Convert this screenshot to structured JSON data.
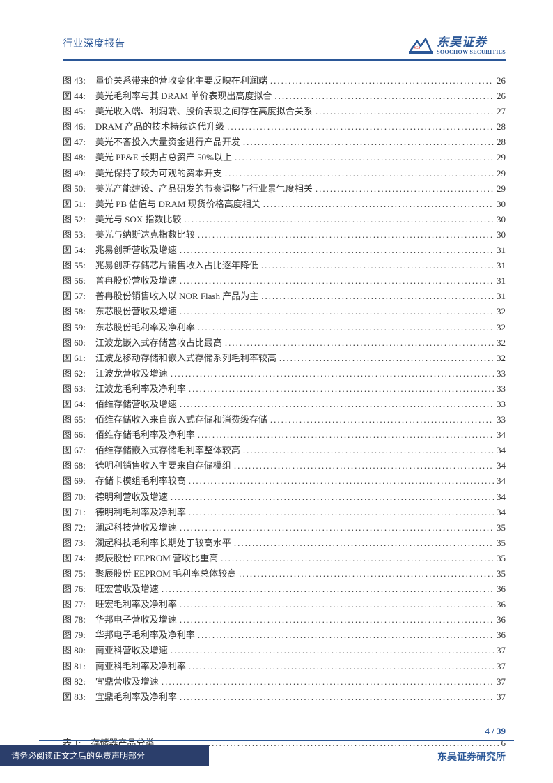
{
  "header": {
    "doc_title": "行业深度报告",
    "logo_cn": "东吴证券",
    "logo_en": "SOOCHOW SECURITIES"
  },
  "toc": {
    "figures": [
      {
        "num": "图 43:",
        "title": "量价关系带来的营收变化主要反映在利润端",
        "page": "26"
      },
      {
        "num": "图 44:",
        "title": "美光毛利率与其 DRAM 单价表现出高度拟合",
        "page": "26"
      },
      {
        "num": "图 45:",
        "title": "美光收入端、利润端、股价表现之间存在高度拟合关系",
        "page": "27"
      },
      {
        "num": "图 46:",
        "title": "DRAM 产品的技术持续迭代升级",
        "page": "28"
      },
      {
        "num": "图 47:",
        "title": "美光不吝投入大量资金进行产品开发",
        "page": "28"
      },
      {
        "num": "图 48:",
        "title": "美光 PP&E 长期占总资产 50%以上",
        "page": "29"
      },
      {
        "num": "图 49:",
        "title": "美光保持了较为可观的资本开支",
        "page": "29"
      },
      {
        "num": "图 50:",
        "title": "美光产能建设、产品研发的节奏调整与行业景气度相关",
        "page": "29"
      },
      {
        "num": "图 51:",
        "title": "美光 PB 估值与 DRAM 现货价格高度相关",
        "page": "30"
      },
      {
        "num": "图 52:",
        "title": "美光与 SOX 指数比较",
        "page": "30"
      },
      {
        "num": "图 53:",
        "title": "美光与纳斯达克指数比较",
        "page": "30"
      },
      {
        "num": "图 54:",
        "title": "兆易创新营收及增速",
        "page": "31"
      },
      {
        "num": "图 55:",
        "title": "兆易创新存储芯片销售收入占比逐年降低",
        "page": "31"
      },
      {
        "num": "图 56:",
        "title": "普冉股份营收及增速",
        "page": "31"
      },
      {
        "num": "图 57:",
        "title": "普冉股份销售收入以 NOR Flash 产品为主",
        "page": "31"
      },
      {
        "num": "图 58:",
        "title": "东芯股份营收及增速",
        "page": "32"
      },
      {
        "num": "图 59:",
        "title": "东芯股份毛利率及净利率",
        "page": "32"
      },
      {
        "num": "图 60:",
        "title": "江波龙嵌入式存储营收占比最高",
        "page": "32"
      },
      {
        "num": "图 61:",
        "title": "江波龙移动存储和嵌入式存储系列毛利率较高",
        "page": "32"
      },
      {
        "num": "图 62:",
        "title": "江波龙营收及增速",
        "page": "33"
      },
      {
        "num": "图 63:",
        "title": "江波龙毛利率及净利率",
        "page": "33"
      },
      {
        "num": "图 64:",
        "title": "佰维存储营收及增速",
        "page": "33"
      },
      {
        "num": "图 65:",
        "title": "佰维存储收入来自嵌入式存储和消费级存储",
        "page": "33"
      },
      {
        "num": "图 66:",
        "title": "佰维存储毛利率及净利率",
        "page": "34"
      },
      {
        "num": "图 67:",
        "title": "佰维存储嵌入式存储毛利率整体较高",
        "page": "34"
      },
      {
        "num": "图 68:",
        "title": "德明利销售收入主要来自存储模组",
        "page": "34"
      },
      {
        "num": "图 69:",
        "title": "存储卡模组毛利率较高",
        "page": "34"
      },
      {
        "num": "图 70:",
        "title": "德明利营收及增速",
        "page": "34"
      },
      {
        "num": "图 71:",
        "title": "德明利毛利率及净利率",
        "page": "34"
      },
      {
        "num": "图 72:",
        "title": "澜起科技营收及增速",
        "page": "35"
      },
      {
        "num": "图 73:",
        "title": "澜起科技毛利率长期处于较高水平",
        "page": "35"
      },
      {
        "num": "图 74:",
        "title": "聚辰股份 EEPROM 营收比重高",
        "page": "35"
      },
      {
        "num": "图 75:",
        "title": "聚辰股份 EEPROM 毛利率总体较高",
        "page": "35"
      },
      {
        "num": "图 76:",
        "title": "旺宏营收及增速",
        "page": "36"
      },
      {
        "num": "图 77:",
        "title": "旺宏毛利率及净利率",
        "page": "36"
      },
      {
        "num": "图 78:",
        "title": "华邦电子营收及增速",
        "page": "36"
      },
      {
        "num": "图 79:",
        "title": "华邦电子毛利率及净利率",
        "page": "36"
      },
      {
        "num": "图 80:",
        "title": "南亚科营收及增速",
        "page": "37"
      },
      {
        "num": "图 81:",
        "title": "南亚科毛利率及净利率",
        "page": "37"
      },
      {
        "num": "图 82:",
        "title": "宜鼎营收及增速",
        "page": "37"
      },
      {
        "num": "图 83:",
        "title": "宜鼎毛利率及净利率",
        "page": "37"
      }
    ],
    "tables": [
      {
        "num": "表 1:",
        "title": "存储器产品分类",
        "page": "6"
      }
    ]
  },
  "footer": {
    "pagenum": "4 / 39",
    "disclaimer": "请务必阅读正文之后的免责声明部分",
    "org": "东吴证券研究所"
  }
}
